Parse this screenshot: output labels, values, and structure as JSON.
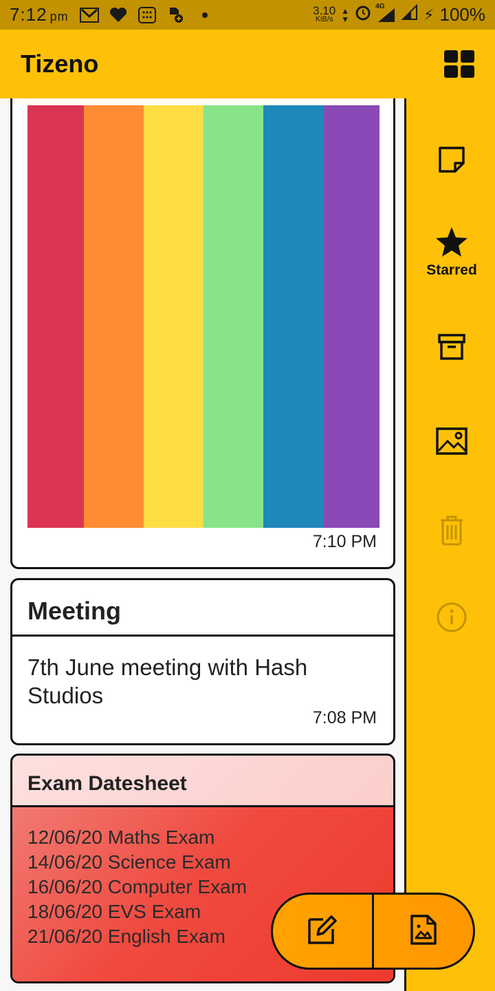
{
  "status_bar": {
    "time": "7:12",
    "ampm": "pm",
    "net_speed_value": "3.10",
    "net_speed_unit": "KiB/s",
    "signal": "4G",
    "battery": "100%"
  },
  "app_bar": {
    "title": "Tizeno",
    "grid_icon": "grid-view-icon"
  },
  "rail": {
    "items": [
      {
        "icon": "note-icon",
        "label": ""
      },
      {
        "icon": "star-icon",
        "label": "Starred",
        "active": true
      },
      {
        "icon": "archive-icon",
        "label": ""
      },
      {
        "icon": "image-icon",
        "label": ""
      },
      {
        "icon": "trash-icon",
        "label": ""
      },
      {
        "icon": "info-icon",
        "label": ""
      }
    ]
  },
  "notes": [
    {
      "type": "image",
      "stripes": [
        "#dc3454",
        "#ff8c33",
        "#ffdd44",
        "#88e48a",
        "#1e88b8",
        "#8a49b6"
      ],
      "time": "7:10 PM"
    },
    {
      "type": "text",
      "title": "Meeting",
      "body": "7th June meeting with Hash Studios",
      "time": "7:08 PM"
    },
    {
      "type": "list",
      "title": "Exam Datesheet",
      "lines": [
        "12/06/20 Maths Exam",
        "14/06/20 Science Exam",
        "16/06/20 Computer Exam",
        "18/06/20 EVS Exam",
        "21/06/20 English Exam"
      ]
    }
  ],
  "fab": {
    "left_icon": "edit-note-icon",
    "right_icon": "image-note-icon"
  },
  "colors": {
    "accent": "#ffc107",
    "status_bar": "#c39200",
    "fab": "#ff9800"
  }
}
